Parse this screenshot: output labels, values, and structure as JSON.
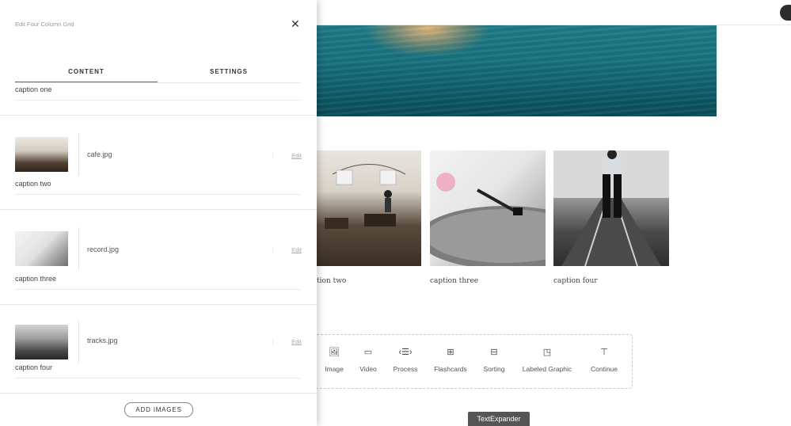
{
  "panel": {
    "title": "Edit Four Column Grid",
    "tabs": [
      "CONTENT",
      "SETTINGS"
    ],
    "first_caption": "caption one",
    "items": [
      {
        "file": "cafe.jpg",
        "edit": "Edit",
        "caption": "caption two"
      },
      {
        "file": "record.jpg",
        "edit": "Edit",
        "caption": "caption three"
      },
      {
        "file": "tracks.jpg",
        "edit": "Edit",
        "caption": "caption four"
      }
    ],
    "add_button": "ADD IMAGES"
  },
  "grid": {
    "captions": [
      "tion two",
      "caption three",
      "caption four"
    ]
  },
  "blocks": [
    {
      "label": "Image",
      "icon": "image-icon"
    },
    {
      "label": "Video",
      "icon": "video-icon"
    },
    {
      "label": "Process",
      "icon": "process-icon"
    },
    {
      "label": "Flashcards",
      "icon": "flashcards-icon"
    },
    {
      "label": "Sorting",
      "icon": "sorting-icon"
    },
    {
      "label": "Labeled Graphic",
      "icon": "labeled-graphic-icon"
    },
    {
      "label": "Continue",
      "icon": "continue-icon"
    }
  ],
  "textexpander": "TextExpander"
}
